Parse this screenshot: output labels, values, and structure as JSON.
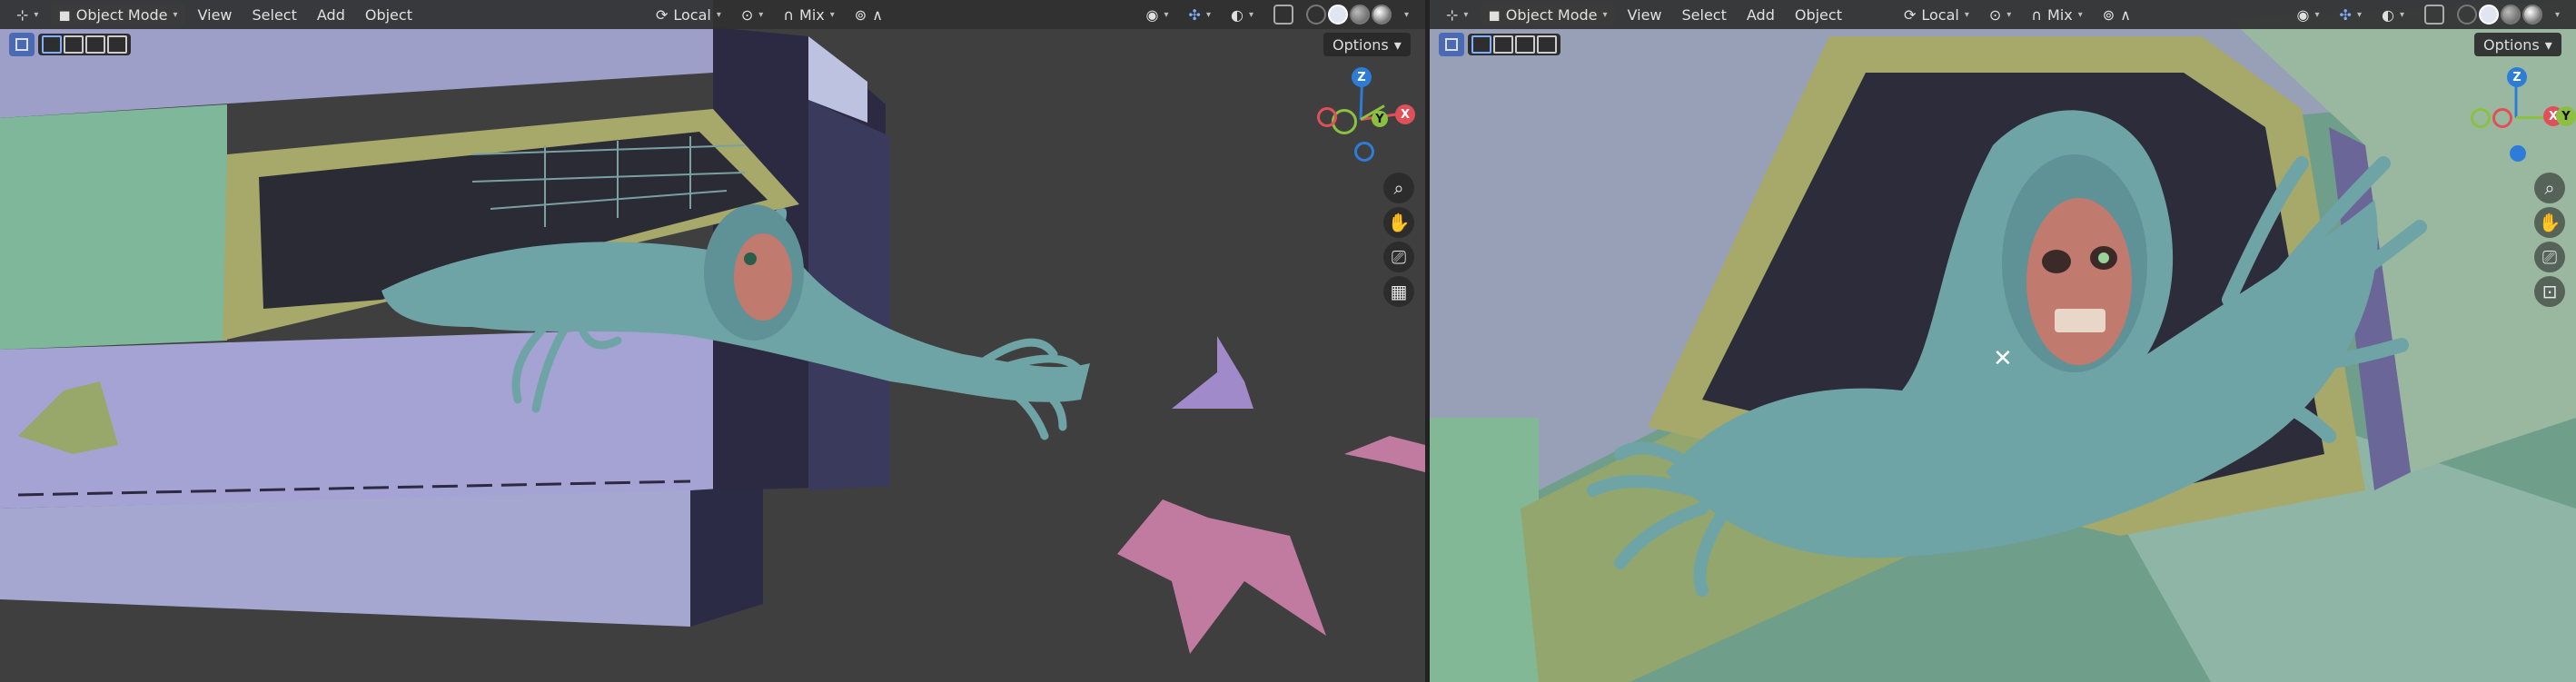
{
  "colors": {
    "viewport_bg_left": "#3f3f3f",
    "header_bg": "#303030",
    "wall_purple": "#a3a4cc",
    "wall_green": "#7fb79a",
    "creature_teal": "#6fa4a7",
    "skull": "#c07a6e",
    "bat_pink": "#c27ba0",
    "bat_lilac": "#a08ac9",
    "frame_green": "#a6a96a"
  },
  "left_viewport": {
    "header": {
      "mode_label": "Object Mode",
      "menus": [
        "View",
        "Select",
        "Add",
        "Object"
      ],
      "transform_orientation": "Local",
      "snap_mode": "Mix"
    },
    "options_label": "Options",
    "gizmo": {
      "z": "Z",
      "x": "X",
      "y": "Y"
    }
  },
  "right_viewport": {
    "header": {
      "mode_label": "Object Mode",
      "menus": [
        "View",
        "Select",
        "Add",
        "Object"
      ],
      "transform_orientation": "Local",
      "snap_mode": "Mix"
    },
    "options_label": "Options",
    "gizmo": {
      "z": "Z",
      "x": "X",
      "y": "Y"
    },
    "cursor_glyph": "✕"
  },
  "icons": {
    "editor_type": "editor-type-icon",
    "mode": "object-mode-icon",
    "orientation": "transform-orientation-icon",
    "pivot": "pivot-point-icon",
    "snap": "snap-magnet-icon",
    "proportional": "proportional-edit-icon",
    "visibility": "visibility-icon",
    "gizmo_toggle": "gizmo-toggle-icon",
    "overlays": "overlays-icon",
    "xray": "xray-icon",
    "zoom": "zoom-icon",
    "pan": "pan-hand-icon",
    "camera": "camera-icon",
    "grid": "perspective-grid-icon",
    "lock": "camera-lock-icon"
  }
}
